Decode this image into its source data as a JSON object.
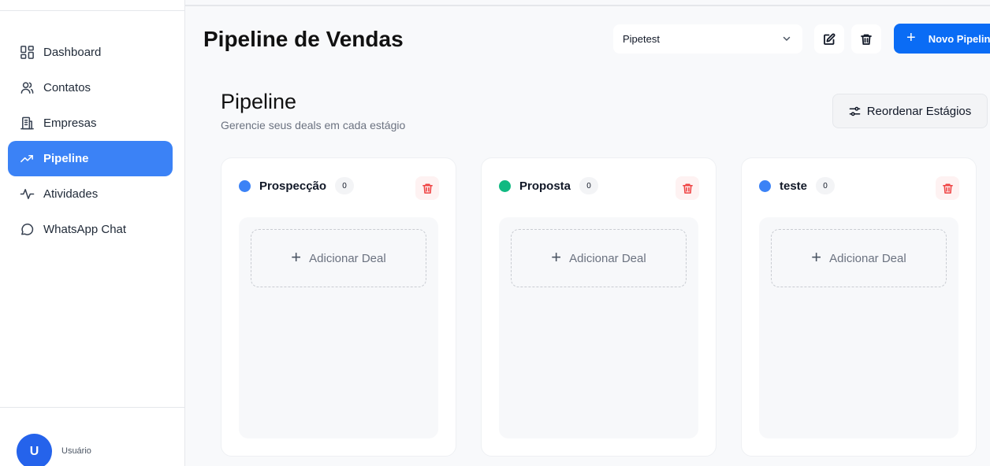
{
  "sidebar": {
    "items": [
      {
        "label": "Dashboard",
        "icon": "dashboard-icon"
      },
      {
        "label": "Contatos",
        "icon": "users-icon"
      },
      {
        "label": "Empresas",
        "icon": "building-icon"
      },
      {
        "label": "Pipeline",
        "icon": "trending-up-icon",
        "active": true
      },
      {
        "label": "Atividades",
        "icon": "activity-icon"
      },
      {
        "label": "WhatsApp Chat",
        "icon": "chat-bubble-icon"
      }
    ],
    "user": {
      "initial": "U",
      "name": "Usuário"
    }
  },
  "header": {
    "title": "Pipeline de Vendas",
    "pipeline_select": "Pipetest",
    "new_pipeline_label": "Novo Pipeline"
  },
  "section": {
    "title": "Pipeline",
    "subtitle": "Gerencie seus deals em cada estágio",
    "reorder_label": "Reordenar Estágios"
  },
  "columns": [
    {
      "name": "Prospecção",
      "count": "0",
      "color": "#3b82f6",
      "add_label": "Adicionar Deal"
    },
    {
      "name": "Proposta",
      "count": "0",
      "color": "#10b981",
      "add_label": "Adicionar Deal"
    },
    {
      "name": "teste",
      "count": "0",
      "color": "#3b82f6",
      "add_label": "Adicionar Deal"
    }
  ],
  "colors": {
    "accent": "#3b82f6",
    "primary_button": "#0a6cf5",
    "danger": "#ef4444"
  }
}
